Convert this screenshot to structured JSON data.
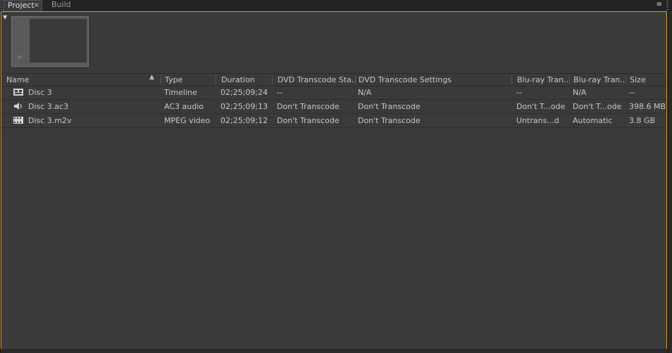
{
  "tabs": [
    {
      "label": "Project",
      "close": "×"
    },
    {
      "label": "Build"
    }
  ],
  "panel_menu_icon": "≡",
  "collapse_icon": "▼",
  "thumbnail": {
    "play_icon": "▶"
  },
  "columns": [
    "Name",
    "Type",
    "Duration",
    "DVD Transcode Sta...",
    "DVD Transcode Settings",
    "Blu-ray Tran...",
    "Blu-ray Tran...",
    "Size"
  ],
  "rows": [
    {
      "icon": "timeline-icon",
      "name": "Disc 3",
      "type": "Timeline",
      "duration": "02;25;09;24",
      "dvd_status": "--",
      "dvd_settings": "N/A",
      "br_status": "--",
      "br_settings": "N/A",
      "size": "--"
    },
    {
      "icon": "audio-icon",
      "name": "Disc 3.ac3",
      "type": "AC3 audio",
      "duration": "02;25;09;13",
      "dvd_status": "Don't Transcode",
      "dvd_settings": "Don't Transcode",
      "br_status": "Don't T...ode",
      "br_settings": "Don't T...ode",
      "size": "398.6 MB"
    },
    {
      "icon": "video-icon",
      "name": "Disc 3.m2v",
      "type": "MPEG video",
      "duration": "02;25;09;12",
      "dvd_status": "Don't Transcode",
      "dvd_settings": "Don't Transcode",
      "br_status": "Untrans...d",
      "br_settings": "Automatic",
      "size": "3.8 GB"
    }
  ]
}
